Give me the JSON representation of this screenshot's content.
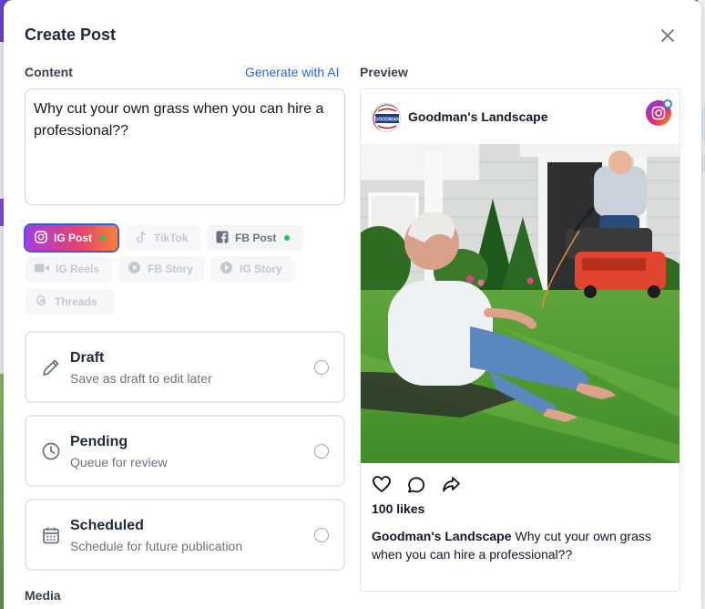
{
  "modal": {
    "title": "Create Post",
    "content_label": "Content",
    "generate_ai": "Generate with AI",
    "preview_label": "Preview",
    "media_label": "Media",
    "content_text": "Why cut your own grass when you can hire a professional??"
  },
  "platforms": [
    {
      "label": "IG Post",
      "icon": "instagram-icon",
      "state": "active",
      "status_dot": true
    },
    {
      "label": "TikTok",
      "icon": "tiktok-icon",
      "state": "disabled",
      "status_dot": false
    },
    {
      "label": "FB Post",
      "icon": "facebook-icon",
      "state": "enabled",
      "status_dot": true
    },
    {
      "label": "IG Reels",
      "icon": "video-icon",
      "state": "disabled",
      "status_dot": false
    },
    {
      "label": "FB Story",
      "icon": "play-circle-icon",
      "state": "disabled",
      "status_dot": false
    },
    {
      "label": "IG Story",
      "icon": "play-circle-icon",
      "state": "disabled",
      "status_dot": false
    },
    {
      "label": "Threads",
      "icon": "threads-icon",
      "state": "disabled",
      "status_dot": false
    }
  ],
  "options": [
    {
      "title": "Draft",
      "subtitle": "Save as draft to edit later",
      "icon": "pencil-icon"
    },
    {
      "title": "Pending",
      "subtitle": "Queue for review",
      "icon": "clock-icon"
    },
    {
      "title": "Scheduled",
      "subtitle": "Schedule for future publication",
      "icon": "calendar-icon"
    }
  ],
  "preview": {
    "account_name": "Goodman's Landscape",
    "avatar_text": "GOODMAN",
    "likes": "100 likes",
    "caption_user": "Goodman's Landscape",
    "caption_text": "Why cut your own grass when you can hire a professional??",
    "image_alt": "man sitting on grass while a professional mows the lawn"
  },
  "colors": {
    "accent": "#2563eb",
    "ig_gradient_start": "#a43ce0",
    "ig_gradient_end": "#f5823a",
    "status_dot": "#22c55e"
  }
}
